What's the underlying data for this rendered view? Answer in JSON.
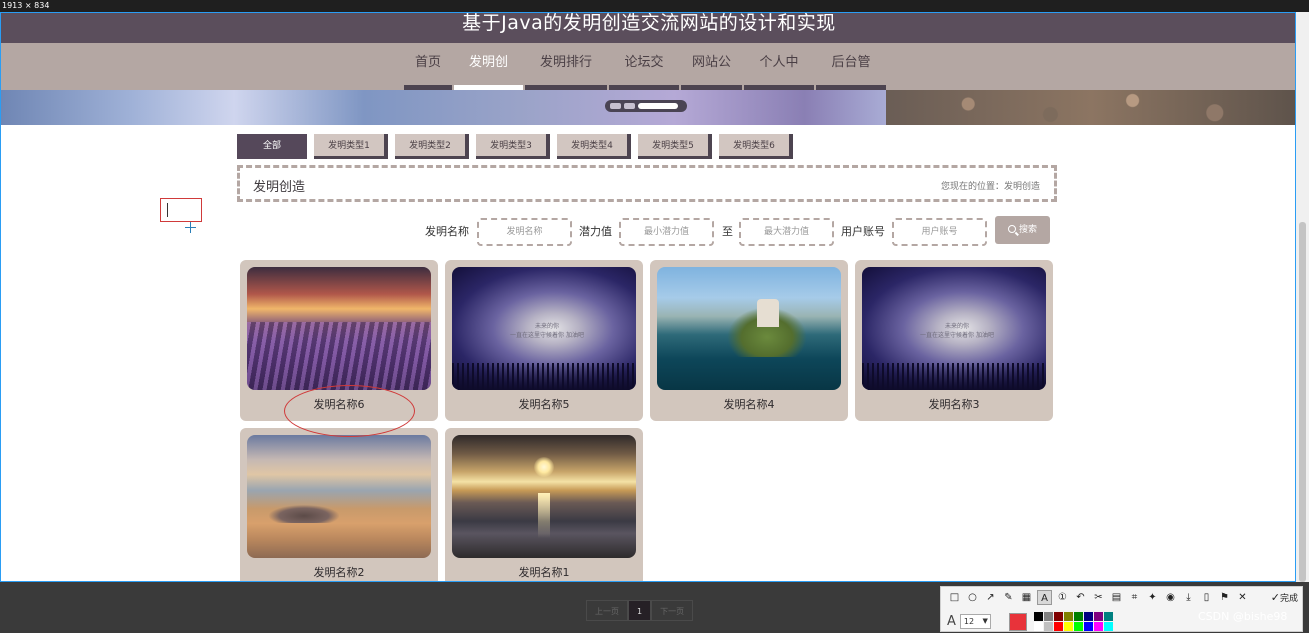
{
  "screen_info": {
    "dimension_label": "1913 × 834"
  },
  "site": {
    "title": "基于Java的发明创造交流网站的设计和实现"
  },
  "nav": {
    "items": [
      {
        "label": "首页",
        "active": false
      },
      {
        "label": "发明创造",
        "active": true
      },
      {
        "label": "发明排行榜",
        "active": false
      },
      {
        "label": "论坛交流",
        "active": false
      },
      {
        "label": "网站公告",
        "active": false
      },
      {
        "label": "个人中心",
        "active": false
      },
      {
        "label": "后台管理",
        "active": false
      }
    ]
  },
  "carousel": {
    "slide_count": 3,
    "active_index": 2
  },
  "category_tabs": [
    {
      "label": "全部",
      "active": true
    },
    {
      "label": "发明类型1",
      "active": false
    },
    {
      "label": "发明类型2",
      "active": false
    },
    {
      "label": "发明类型3",
      "active": false
    },
    {
      "label": "发明类型4",
      "active": false
    },
    {
      "label": "发明类型5",
      "active": false
    },
    {
      "label": "发明类型6",
      "active": false
    }
  ],
  "breadcrumb": {
    "title": "发明创造",
    "location": "您现在的位置：发明创造"
  },
  "search": {
    "name_label": "发明名称",
    "name_placeholder": "发明名称",
    "potential_label": "潜力值",
    "min_placeholder": "最小潜力值",
    "to_label": "至",
    "max_placeholder": "最大潜力值",
    "account_label": "用户账号",
    "account_placeholder": "用户账号",
    "button_label": "搜索"
  },
  "cards": [
    {
      "name": "发明名称6",
      "image": "lavender-field-sunset"
    },
    {
      "name": "发明名称5",
      "image": "future-sky-poster"
    },
    {
      "name": "发明名称4",
      "image": "island-castle-lake"
    },
    {
      "name": "发明名称3",
      "image": "future-sky-poster"
    },
    {
      "name": "发明名称2",
      "image": "sunset-cloud-sky"
    },
    {
      "name": "发明名称1",
      "image": "sunset-over-sea"
    }
  ],
  "poster_text": {
    "line1": "未来的你",
    "line2": "一直在这里守候着你 加油吧"
  },
  "pagination": {
    "prev": "上一页",
    "current": "1",
    "next": "下一页"
  },
  "screenshot_tool": {
    "tools": [
      "rectangle-icon",
      "ellipse-icon",
      "arrow-icon",
      "pencil-icon",
      "mosaic-icon",
      "text-icon",
      "number-icon",
      "undo-icon",
      "cut-icon",
      "ocr-icon",
      "crop-icon",
      "pin-icon",
      "record-icon",
      "download-icon",
      "save-icon",
      "favorite-icon",
      "close-icon"
    ],
    "done_label": "完成",
    "font_size": "12",
    "current_color": "#e8333a",
    "palette": [
      "#000000",
      "#808080",
      "#800000",
      "#808000",
      "#008000",
      "#000080",
      "#800080",
      "#008080",
      "#ffffff",
      "#c0c0c0",
      "#ff0000",
      "#ffff00",
      "#00ff00",
      "#0000ff",
      "#ff00ff",
      "#00ffff"
    ]
  },
  "watermark": "CSDN @bishe98"
}
